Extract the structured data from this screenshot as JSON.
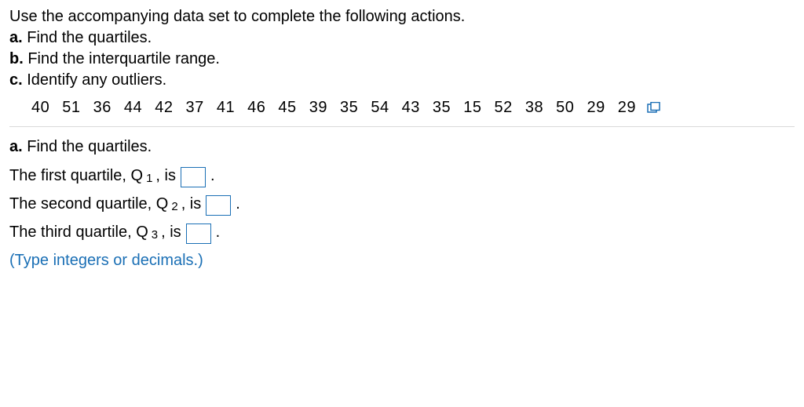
{
  "prompt": {
    "intro": "Use the accompanying data set to complete the following actions.",
    "items": [
      {
        "label": "a.",
        "text": "Find the quartiles."
      },
      {
        "label": "b.",
        "text": "Find the interquartile range."
      },
      {
        "label": "c.",
        "text": "Identify any outliers."
      }
    ]
  },
  "data_set": {
    "values": [
      40,
      51,
      36,
      44,
      42,
      37,
      41,
      46,
      45,
      39,
      35,
      54,
      43,
      35,
      15,
      52,
      38,
      50,
      29,
      29
    ],
    "display": "40  51  36  44  42  37  41  46  45  39  35  54  43  35  15  52  38  50  29  29"
  },
  "section_a": {
    "label": "a.",
    "title": "Find the quartiles.",
    "lines": {
      "q1": {
        "pre": "The first quartile, Q",
        "sub": "1",
        "post": ", is",
        "period": "."
      },
      "q2": {
        "pre": "The second quartile, Q",
        "sub": "2",
        "post": ", is",
        "period": "."
      },
      "q3": {
        "pre": "The third quartile, Q",
        "sub": "3",
        "post": ", is",
        "period": "."
      }
    },
    "hint": "(Type integers or decimals.)"
  },
  "icons": {
    "copy": "copy-icon"
  }
}
